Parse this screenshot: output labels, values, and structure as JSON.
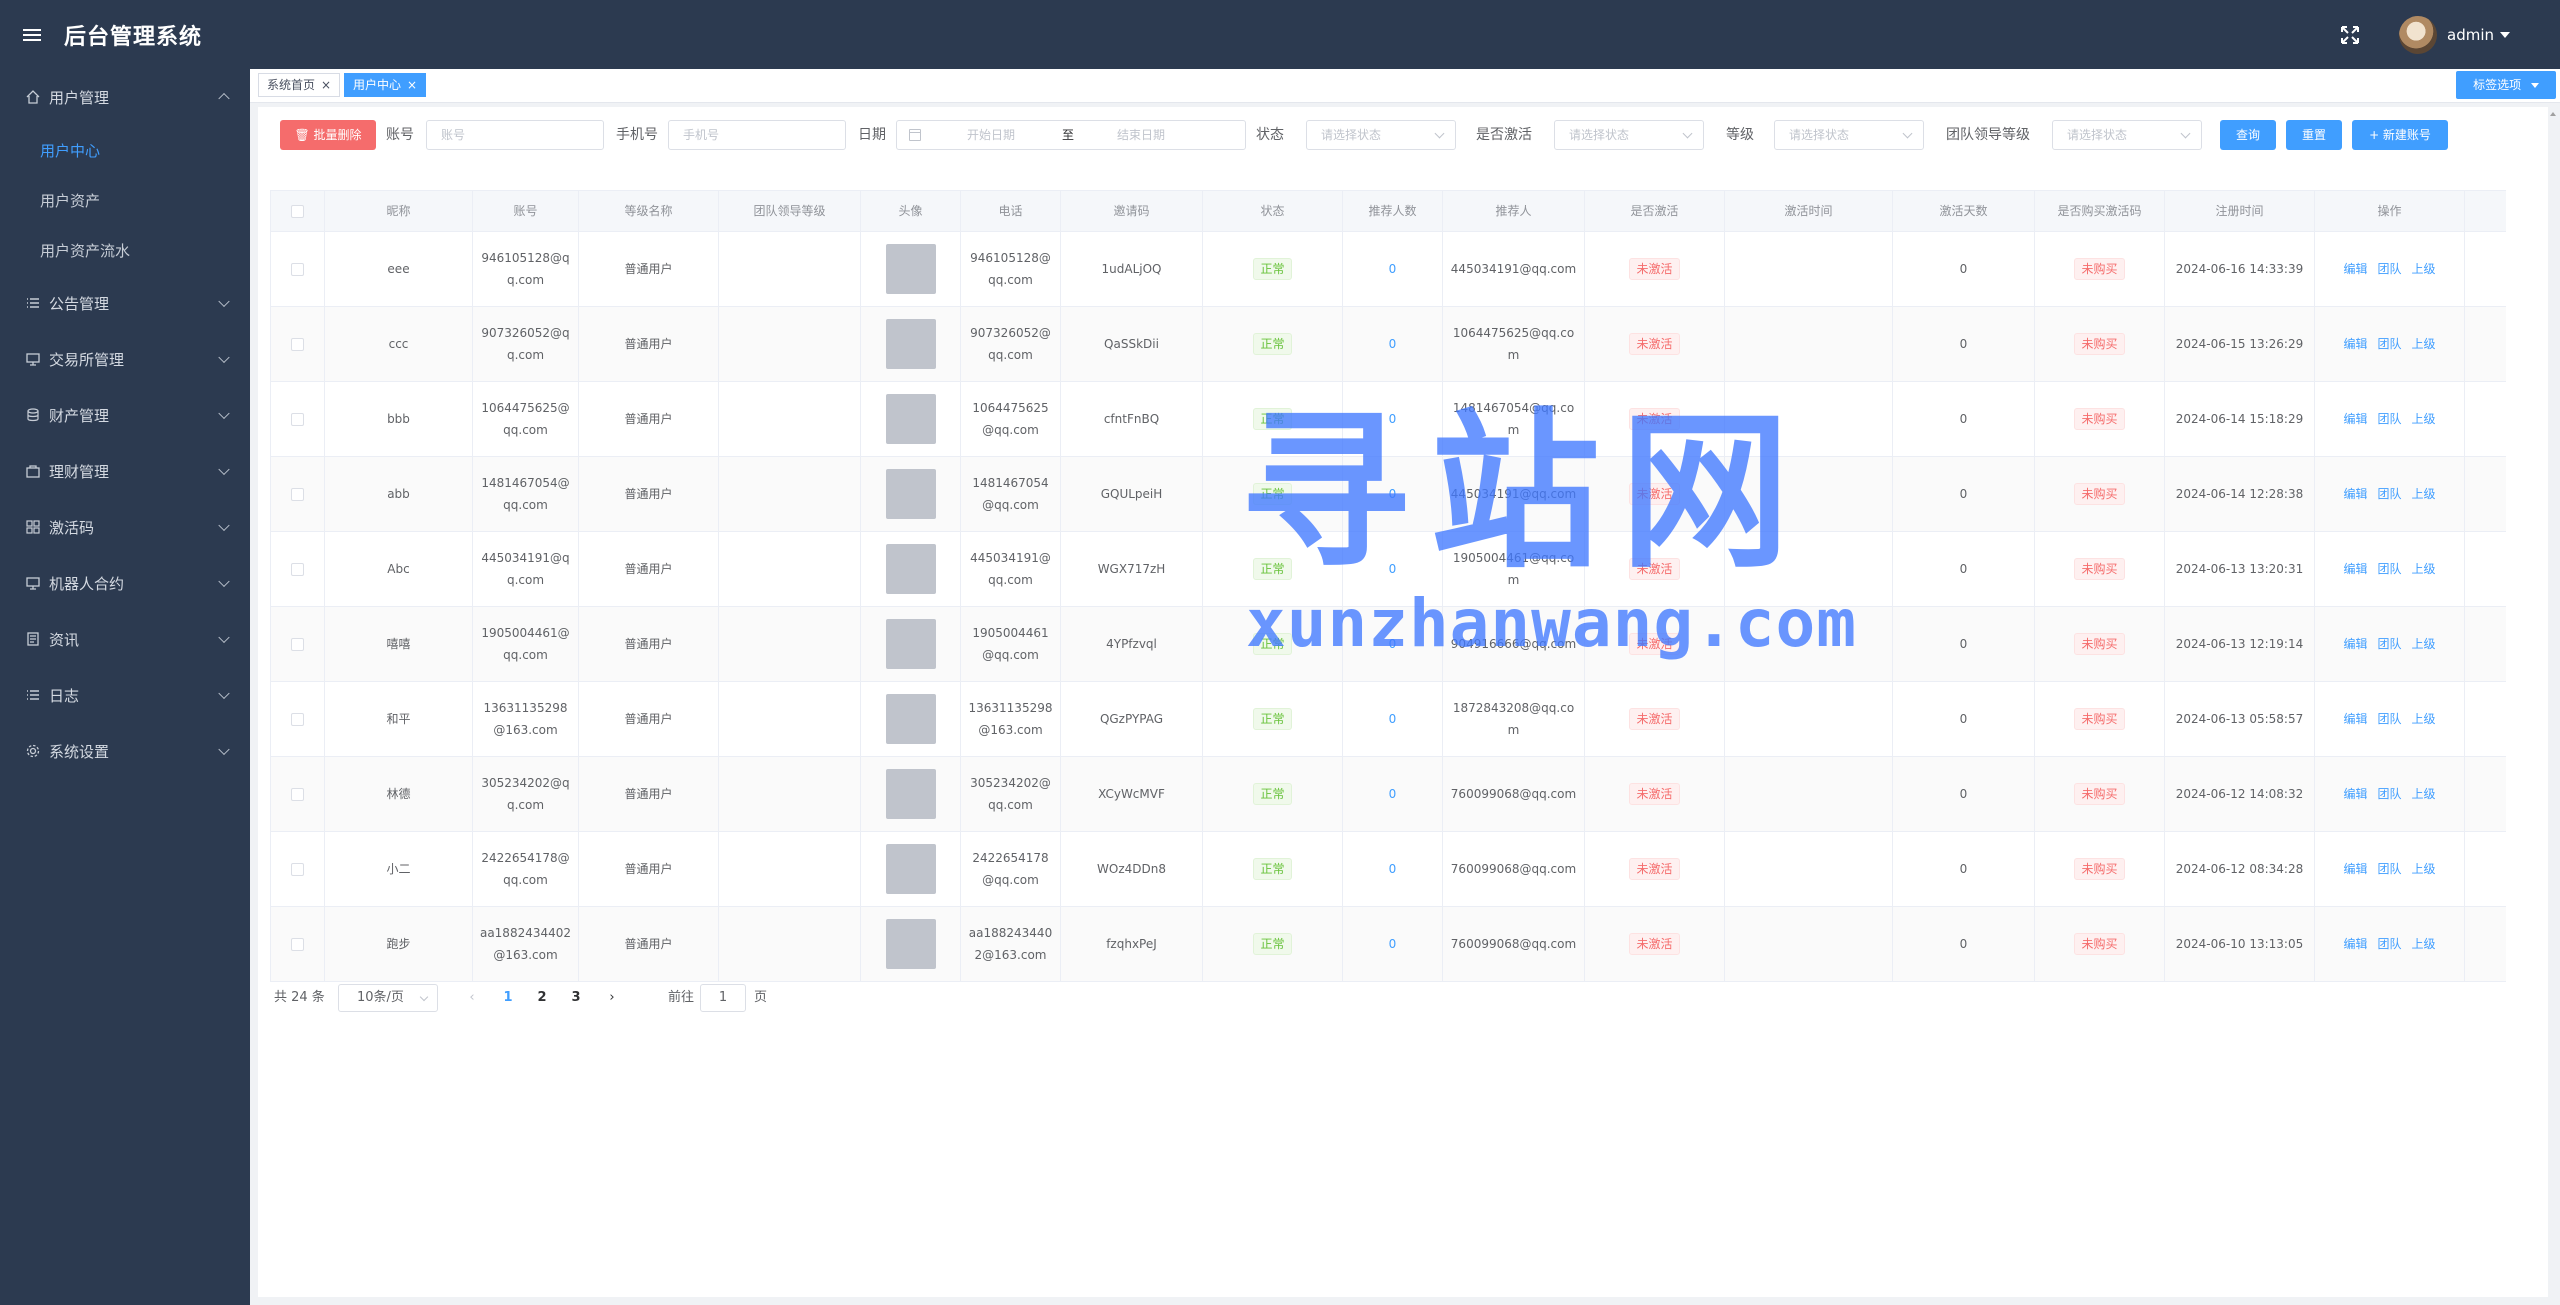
{
  "app": {
    "title": "后台管理系统",
    "user": "admin"
  },
  "sidebar": {
    "groups": [
      {
        "label": "用户管理",
        "icon": "home-icon",
        "expanded": true,
        "children": [
          {
            "label": "用户中心",
            "active": true
          },
          {
            "label": "用户资产"
          },
          {
            "label": "用户资产流水"
          }
        ]
      },
      {
        "label": "公告管理",
        "icon": "list-icon"
      },
      {
        "label": "交易所管理",
        "icon": "monitor-icon"
      },
      {
        "label": "财产管理",
        "icon": "database-icon"
      },
      {
        "label": "理财管理",
        "icon": "bag-icon"
      },
      {
        "label": "激活码",
        "icon": "grid-icon"
      },
      {
        "label": "机器人合约",
        "icon": "monitor-icon"
      },
      {
        "label": "资讯",
        "icon": "document-icon"
      },
      {
        "label": "日志",
        "icon": "list-icon"
      },
      {
        "label": "系统设置",
        "icon": "gear-icon"
      }
    ]
  },
  "tags": {
    "items": [
      {
        "label": "系统首页",
        "active": false
      },
      {
        "label": "用户中心",
        "active": true
      }
    ],
    "options_label": "标签选项"
  },
  "filter": {
    "batch_delete": "批量删除",
    "account_label": "账号",
    "account_placeholder": "账号",
    "phone_label": "手机号",
    "phone_placeholder": "手机号",
    "date_label": "日期",
    "date_start": "开始日期",
    "date_sep": "至",
    "date_end": "结束日期",
    "status_label": "状态",
    "status_placeholder": "请选择状态",
    "activated_label": "是否激活",
    "activated_placeholder": "请选择状态",
    "level_label": "等级",
    "level_placeholder": "请选择状态",
    "team_level_label": "团队领导等级",
    "team_level_placeholder": "请选择状态",
    "query": "查询",
    "reset": "重置",
    "add": "+ 新建账号"
  },
  "table": {
    "columns": [
      "昵称",
      "账号",
      "等级名称",
      "团队领导等级",
      "头像",
      "电话",
      "邀请码",
      "状态",
      "推荐人数",
      "推荐人",
      "是否激活",
      "激活时间",
      "激活天数",
      "是否购买激活码",
      "注册时间",
      "操作"
    ],
    "ops": [
      "编辑",
      "团队",
      "上级"
    ],
    "rows": [
      {
        "nick": "eee",
        "account": "946105128@qq.com",
        "level": "普通用户",
        "phone": "946105128@qq.com",
        "invite": "1udALjOQ",
        "status": "正常",
        "ref_count": "0",
        "referrer": "445034191@qq.com",
        "activated": "未激活",
        "days": "0",
        "bought": "未购买",
        "reg": "2024-06-16 14:33:39"
      },
      {
        "nick": "ccc",
        "account": "907326052@qq.com",
        "level": "普通用户",
        "phone": "907326052@qq.com",
        "invite": "QaSSkDii",
        "status": "正常",
        "ref_count": "0",
        "referrer": "1064475625@qq.com",
        "activated": "未激活",
        "days": "0",
        "bought": "未购买",
        "reg": "2024-06-15 13:26:29"
      },
      {
        "nick": "bbb",
        "account": "1064475625@qq.com",
        "level": "普通用户",
        "phone": "1064475625@qq.com",
        "invite": "cfntFnBQ",
        "status": "正常",
        "ref_count": "0",
        "referrer": "1481467054@qq.com",
        "activated": "未激活",
        "days": "0",
        "bought": "未购买",
        "reg": "2024-06-14 15:18:29"
      },
      {
        "nick": "abb",
        "account": "1481467054@qq.com",
        "level": "普通用户",
        "phone": "1481467054@qq.com",
        "invite": "GQULpeiH",
        "status": "正常",
        "ref_count": "0",
        "referrer": "445034191@qq.com",
        "activated": "未激活",
        "days": "0",
        "bought": "未购买",
        "reg": "2024-06-14 12:28:38"
      },
      {
        "nick": "Abc",
        "account": "445034191@qq.com",
        "level": "普通用户",
        "phone": "445034191@qq.com",
        "invite": "WGX717zH",
        "status": "正常",
        "ref_count": "0",
        "referrer": "1905004461@qq.com",
        "activated": "未激活",
        "days": "0",
        "bought": "未购买",
        "reg": "2024-06-13 13:20:31"
      },
      {
        "nick": "嘻嘻",
        "account": "1905004461@qq.com",
        "level": "普通用户",
        "phone": "1905004461@qq.com",
        "invite": "4YPfzvql",
        "status": "正常",
        "ref_count": "0",
        "referrer": "904916666@qq.com",
        "activated": "未激活",
        "days": "0",
        "bought": "未购买",
        "reg": "2024-06-13 12:19:14"
      },
      {
        "nick": "和平",
        "account": "13631135298@163.com",
        "level": "普通用户",
        "phone": "13631135298@163.com",
        "invite": "QGzPYPAG",
        "status": "正常",
        "ref_count": "0",
        "referrer": "1872843208@qq.com",
        "activated": "未激活",
        "days": "0",
        "bought": "未购买",
        "reg": "2024-06-13 05:58:57"
      },
      {
        "nick": "林德",
        "account": "305234202@qq.com",
        "level": "普通用户",
        "phone": "305234202@qq.com",
        "invite": "XCyWcMVF",
        "status": "正常",
        "ref_count": "0",
        "referrer": "760099068@qq.com",
        "activated": "未激活",
        "days": "0",
        "bought": "未购买",
        "reg": "2024-06-12 14:08:32"
      },
      {
        "nick": "小二",
        "account": "2422654178@qq.com",
        "level": "普通用户",
        "phone": "2422654178@qq.com",
        "invite": "WOz4DDn8",
        "status": "正常",
        "ref_count": "0",
        "referrer": "760099068@qq.com",
        "activated": "未激活",
        "days": "0",
        "bought": "未购买",
        "reg": "2024-06-12 08:34:28"
      },
      {
        "nick": "跑步",
        "account": "aa1882434402@163.com",
        "level": "普通用户",
        "phone": "aa1882434402@163.com",
        "invite": "fzqhxPeJ",
        "status": "正常",
        "ref_count": "0",
        "referrer": "760099068@qq.com",
        "activated": "未激活",
        "days": "0",
        "bought": "未购买",
        "reg": "2024-06-10 13:13:05"
      }
    ]
  },
  "pager": {
    "total": "共 24 条",
    "size": "10条/页",
    "pages": [
      "1",
      "2",
      "3"
    ],
    "current": "1",
    "jump_label": "前往",
    "jump_value": "1",
    "page_suffix": "页"
  },
  "watermark": {
    "big": "寻站网",
    "small": "xunzhanwang.com"
  },
  "colors": {
    "sidebar": "#2c3a50",
    "primary": "#409eff",
    "danger": "#f56c6c",
    "success": "#67c23a"
  }
}
